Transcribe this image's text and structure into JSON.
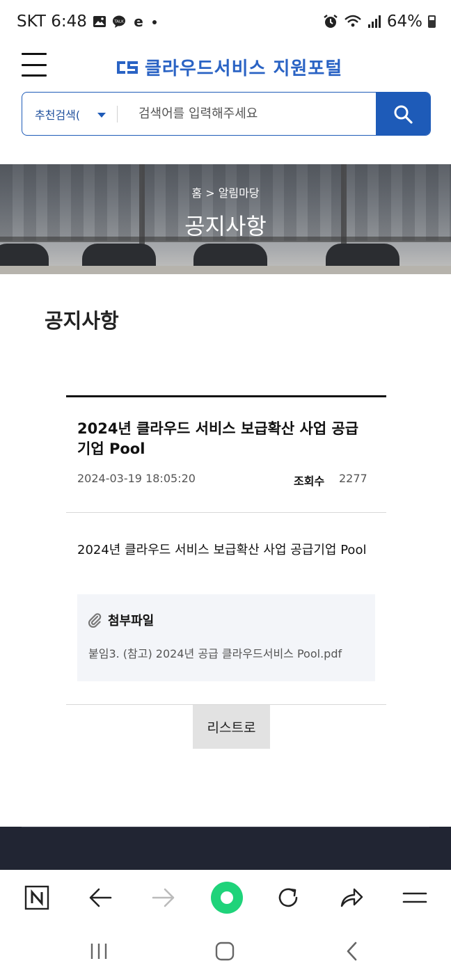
{
  "status_bar": {
    "carrier_time": "SKT 6:48",
    "battery": "64%",
    "icons": [
      "gallery-icon",
      "kakaotalk-icon",
      "e-icon",
      "dot-icon",
      "alarm-icon",
      "wifi-icon",
      "signal-icon",
      "battery-icon"
    ]
  },
  "header": {
    "logo_text": "클라우드서비스 지원포털",
    "brand_color": "#2a63c4"
  },
  "search": {
    "select_value": "추천검색(",
    "placeholder": "검색어를 입력해주세요",
    "button_color": "#1e5bb8"
  },
  "hero": {
    "breadcrumb": "홈 > 알림마당",
    "title": "공지사항"
  },
  "page": {
    "title": "공지사항"
  },
  "article": {
    "title": "2024년 클라우드 서비스 보급확산 사업 공급기업 Pool",
    "date": "2024-03-19 18:05:20",
    "views_label": "조회수",
    "views_count": "2277",
    "body": "2024년 클라우드 서비스 보급확산 사업 공급기업 Pool",
    "attachment_heading": "첨부파일",
    "attachment_file": "붙임3. (참고) 2024년 공급 클라우드서비스 Pool.pdf"
  },
  "actions": {
    "list_button": "리스트로"
  },
  "browser_bar": {
    "icons": [
      "naver-home-icon",
      "back-arrow-icon",
      "forward-arrow-icon",
      "green-dot-icon",
      "refresh-icon",
      "share-icon",
      "menu-icon"
    ]
  },
  "system_nav": {
    "icons": [
      "recent-apps-icon",
      "home-icon",
      "back-icon"
    ]
  }
}
